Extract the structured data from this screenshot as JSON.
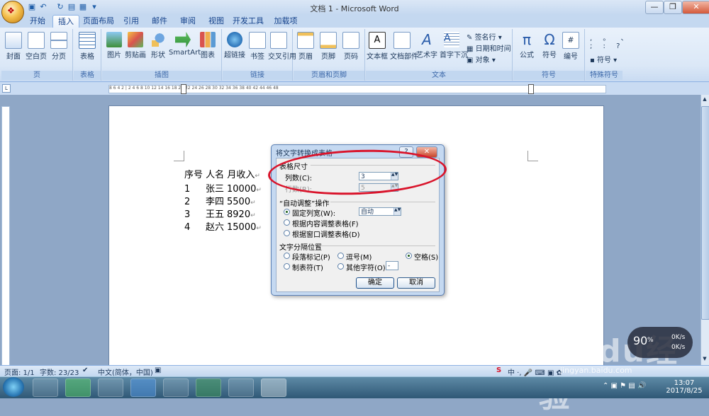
{
  "window": {
    "title": "文档 1 - Microsoft Word"
  },
  "tabs": [
    "开始",
    "插入",
    "页面布局",
    "引用",
    "邮件",
    "审阅",
    "视图",
    "开发工具",
    "加载项"
  ],
  "active_tab": "插入",
  "ribbon": {
    "groups": {
      "page": {
        "label": "页",
        "buttons": [
          "封面",
          "空白页",
          "分页"
        ]
      },
      "table": {
        "label": "表格",
        "buttons": [
          "表格"
        ]
      },
      "illustrations": {
        "label": "插图",
        "buttons": [
          "图片",
          "剪贴画",
          "形状",
          "SmartArt",
          "图表"
        ]
      },
      "links": {
        "label": "链接",
        "buttons": [
          "超链接",
          "书签",
          "交叉引用"
        ]
      },
      "header_footer": {
        "label": "页眉和页脚",
        "buttons": [
          "页眉",
          "页脚",
          "页码"
        ]
      },
      "text": {
        "label": "文本",
        "buttons": [
          "文本框",
          "文档部件",
          "艺术字",
          "首字下沉"
        ],
        "small": [
          "签名行",
          "日期和时间",
          "对象"
        ]
      },
      "symbols": {
        "label": "符号",
        "buttons": [
          "公式",
          "符号",
          "编号"
        ]
      },
      "special": {
        "label": "特殊符号",
        "small": [
          "符号"
        ]
      }
    }
  },
  "ruler": {
    "ticks": "8 6 4 2 | 2 4 6 8 10 12 14 16 18 20 22 24 26 28 30 32 34 36 38 40 42 44 46 48"
  },
  "document": {
    "lines": [
      [
        "序号",
        "人名",
        "月收入"
      ],
      [
        "1",
        "张三",
        "10000"
      ],
      [
        "2",
        "李四",
        "5500"
      ],
      [
        "3",
        "王五",
        "8920"
      ],
      [
        "4",
        "赵六",
        "15000"
      ]
    ],
    "para_mark": "↵"
  },
  "dialog": {
    "title": "将文字转换成表格",
    "section_size": "表格尺寸",
    "cols_label": "列数(C):",
    "cols_value": "3",
    "rows_label": "行数(R):",
    "rows_value": "5",
    "section_autofit": "“自动调整”操作",
    "fixed_width_label": "固定列宽(W):",
    "fixed_width_value": "自动",
    "autofit_content": "根据内容调整表格(F)",
    "autofit_window": "根据窗口调整表格(D)",
    "section_separator": "文字分隔位置",
    "sep_paragraph": "段落标记(P)",
    "sep_comma": "逗号(M)",
    "sep_space": "空格(S)",
    "sep_tab": "制表符(T)",
    "sep_other": "其他字符(O):",
    "sep_other_value": "-",
    "ok": "确定",
    "cancel": "取消",
    "help": "?",
    "close": "✕"
  },
  "statusbar": {
    "page": "页面: 1/1",
    "words": "字数: 23/23",
    "language": "中文(简体，中国)"
  },
  "speed": {
    "value": "90",
    "unit": "%",
    "up": "0K/s",
    "down": "0K/s"
  },
  "watermark": {
    "text": "Baidu经验",
    "url": "jingyan.baidu.com"
  },
  "clock": {
    "time": "13:07",
    "date": "2017/8/25"
  },
  "colors": {
    "annotation_circle": "#d9142b",
    "ribbon_bg": "#dbe8f7"
  }
}
